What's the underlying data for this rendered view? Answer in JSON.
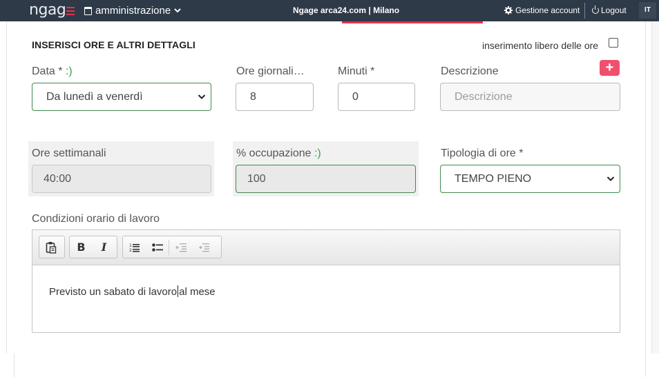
{
  "topbar": {
    "logo": "ngag",
    "module": "amministrazione",
    "center_title": "Ngage arca24.com | Milano",
    "account": "Gestione account",
    "logout": "Logout",
    "lang": "IT",
    "accent": "#e5334b",
    "bg": "#2e3a48"
  },
  "form": {
    "title": "INSERISCI ORE E ALTRI DETTAGLI",
    "free_hours_label": "inserimento libero delle ore",
    "free_hours_checked": false,
    "data_label": "Data *",
    "data_smile": ":)",
    "data_value": "Da lunedì a venerdì",
    "ore_label": "Ore giornali…",
    "ore_value": "8",
    "minuti_label": "Minuti *",
    "minuti_value": "0",
    "descrizione_label": "Descrizione",
    "descrizione_placeholder": "Descrizione",
    "add_symbol": "+",
    "ore_sett_label": "Ore settimanali",
    "ore_sett_value": "40:00",
    "occupazione_label": "% occupazione",
    "occupazione_smile": ":)",
    "occupazione_value": "100",
    "tipologia_label": "Tipologia di ore *",
    "tipologia_value": "TEMPO PIENO",
    "condizioni_label": "Condizioni orario di lavoro",
    "condizioni_text_before_caret": "Previsto un sabato di lavoro",
    "condizioni_text_after_caret": "al mese"
  },
  "editor_toolbar": {
    "bold": "B",
    "italic": "I",
    "icons": [
      "paste-icon",
      "bold-icon",
      "italic-icon",
      "ordered-list-icon",
      "bullet-list-icon",
      "outdent-icon",
      "indent-icon"
    ]
  }
}
